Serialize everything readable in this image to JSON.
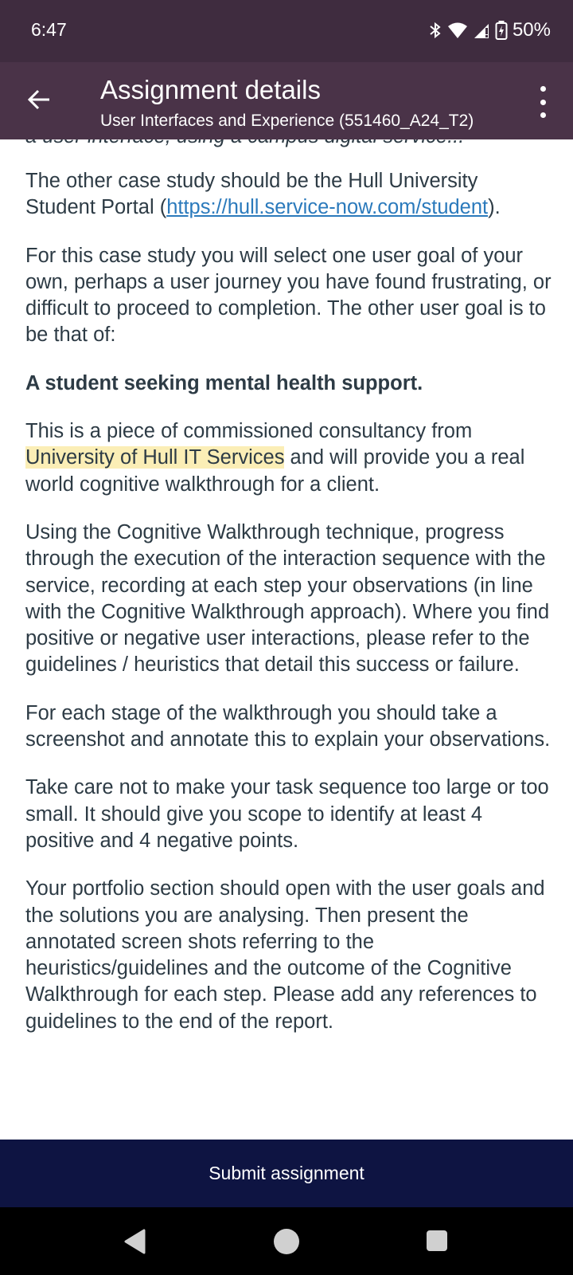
{
  "status_bar": {
    "time": "6:47",
    "battery": "50%"
  },
  "app_bar": {
    "title": "Assignment details",
    "subtitle": "User Interfaces and Experience (551460_A24_T2)"
  },
  "content": {
    "clipped_line": "a user interface, using a campus digital service...",
    "p1": {
      "before": "The other case study should be the Hull University Student Portal (",
      "link": "https://hull.service-now.com/student",
      "after": ")."
    },
    "p2": "For this case study you will select one user goal of your own, perhaps a user journey you have found frustrating, or difficult to proceed to completion. The other user goal is to be that of:",
    "p3_bold": "A student seeking mental health support.",
    "p4": {
      "before": "This is a piece of commissioned consultancy from ",
      "highlight": "University of Hull IT Services",
      "after": " and will provide you a real world cognitive walkthrough for a client."
    },
    "p5": "Using the Cognitive Walkthrough technique, progress through the execution of the interaction sequence with the service, recording at each step your observations (in line with the Cognitive Walkthrough approach). Where you find positive or negative user interactions, please refer to the guidelines / heuristics that detail this success or failure.",
    "p6": "For each stage of the walkthrough you should take a screenshot and annotate this to explain your observations.",
    "p7": "Take care not to make your task sequence too large or too small. It should give you scope to identify at least 4 positive and 4 negative points.",
    "p8": "Your portfolio section should open with the user goals and the solutions you are analysing. Then present the annotated screen shots referring to the heuristics/guidelines and the outcome of the Cognitive Walkthrough for each step. Please add any references to guidelines to the end of the report."
  },
  "submit_label": "Submit assignment",
  "colors": {
    "status_bar": "#3f2c3f",
    "app_bar": "#4a3348",
    "text": "#2d3b45",
    "link": "#2b7abc",
    "highlight": "#fbeeb6",
    "submit_bar": "#0e1442"
  },
  "icons": {
    "back": "arrow-left-icon",
    "more": "more-vertical-icon",
    "bluetooth": "bluetooth-icon",
    "wifi": "wifi-icon",
    "signal": "signal-icon",
    "battery": "battery-icon"
  }
}
